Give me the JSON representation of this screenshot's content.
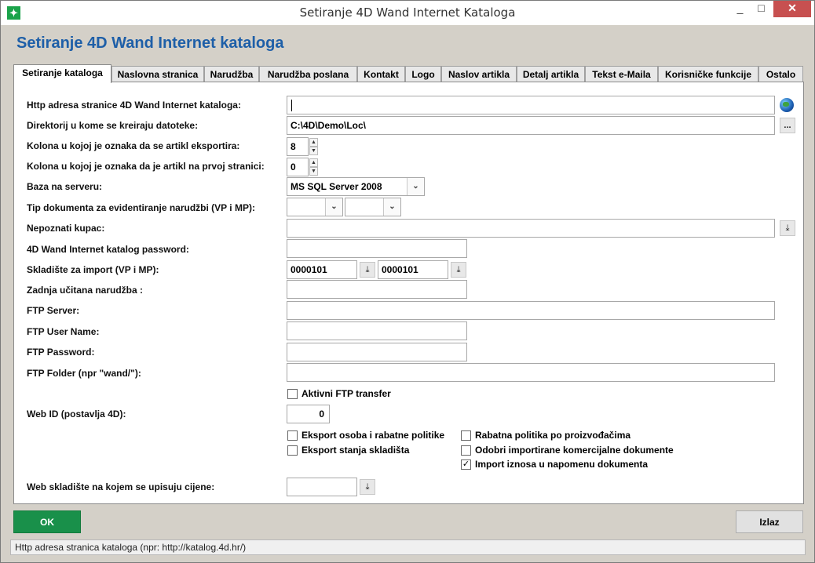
{
  "window": {
    "title": "Setiranje 4D Wand Internet Kataloga",
    "minimize": "_",
    "maximize": "□",
    "close": "✕"
  },
  "heading": "Setiranje 4D Wand Internet kataloga",
  "tabs": [
    {
      "label": "Setiranje kataloga",
      "active": true
    },
    {
      "label": "Naslovna stranica"
    },
    {
      "label": "Narudžba"
    },
    {
      "label": "Narudžba poslana"
    },
    {
      "label": "Kontakt"
    },
    {
      "label": "Logo"
    },
    {
      "label": "Naslov artikla"
    },
    {
      "label": "Detalj artikla"
    },
    {
      "label": "Tekst e-Maila"
    },
    {
      "label": "Korisničke funkcije"
    },
    {
      "label": "Ostalo"
    }
  ],
  "form": {
    "http_address": {
      "label": "Http adresa stranice 4D Wand Internet kataloga:",
      "value": ""
    },
    "directory": {
      "label": "Direktorij u kome se kreiraju datoteke:",
      "value": "C:\\4D\\Demo\\Loc\\"
    },
    "export_column": {
      "label": "Kolona u kojoj je oznaka da se artikl eksportira:",
      "value": "8"
    },
    "first_page_column": {
      "label": "Kolona u kojoj je oznaka da je artikl na prvoj stranici:",
      "value": "0"
    },
    "server_db": {
      "label": "Baza na serveru:",
      "value": "MS SQL Server 2008"
    },
    "doc_type": {
      "label": "Tip dokumenta za evidentiranje narudžbi (VP i MP):",
      "vp": "",
      "mp": ""
    },
    "unknown_customer": {
      "label": "Nepoznati kupac:",
      "value": ""
    },
    "catalog_password": {
      "label": "4D Wand Internet katalog password:",
      "value": ""
    },
    "warehouse_import": {
      "label": "Skladište za import (VP i MP):",
      "vp": "0000101",
      "mp": "0000101"
    },
    "last_order": {
      "label": "Zadnja učitana narudžba :",
      "value": ""
    },
    "ftp_server": {
      "label": "FTP Server:",
      "value": ""
    },
    "ftp_user": {
      "label": "FTP User Name:",
      "value": ""
    },
    "ftp_password": {
      "label": "FTP Password:",
      "value": ""
    },
    "ftp_folder": {
      "label": "FTP Folder (npr \"wand/\"):",
      "value": ""
    },
    "active_ftp": {
      "label": "Aktivni FTP transfer",
      "checked": false
    },
    "web_id": {
      "label": "Web ID (postavlja 4D):",
      "value": "0"
    },
    "export_persons": {
      "label": "Eksport osoba i rabatne politike",
      "checked": false
    },
    "export_stock": {
      "label": "Eksport stanja skladišta",
      "checked": false
    },
    "rebate_by_manufacturer": {
      "label": "Rabatna politika po proizvođačima",
      "checked": false
    },
    "approve_imported": {
      "label": "Odobri importirane komercijalne dokumente",
      "checked": false
    },
    "import_amount_note": {
      "label": "Import iznosa u napomenu dokumenta",
      "checked": true
    },
    "web_warehouse": {
      "label": "Web skladište na kojem se upisuju cijene:",
      "value": ""
    }
  },
  "buttons": {
    "ok": "OK",
    "exit": "Izlaz"
  },
  "icons": {
    "spin_up": "▲",
    "spin_down": "▼",
    "dropdown": "⌄",
    "download": "⤓",
    "ellipsis": "...",
    "check": "✓"
  },
  "status": "Http adresa stranica kataloga (npr: http://katalog.4d.hr/)"
}
